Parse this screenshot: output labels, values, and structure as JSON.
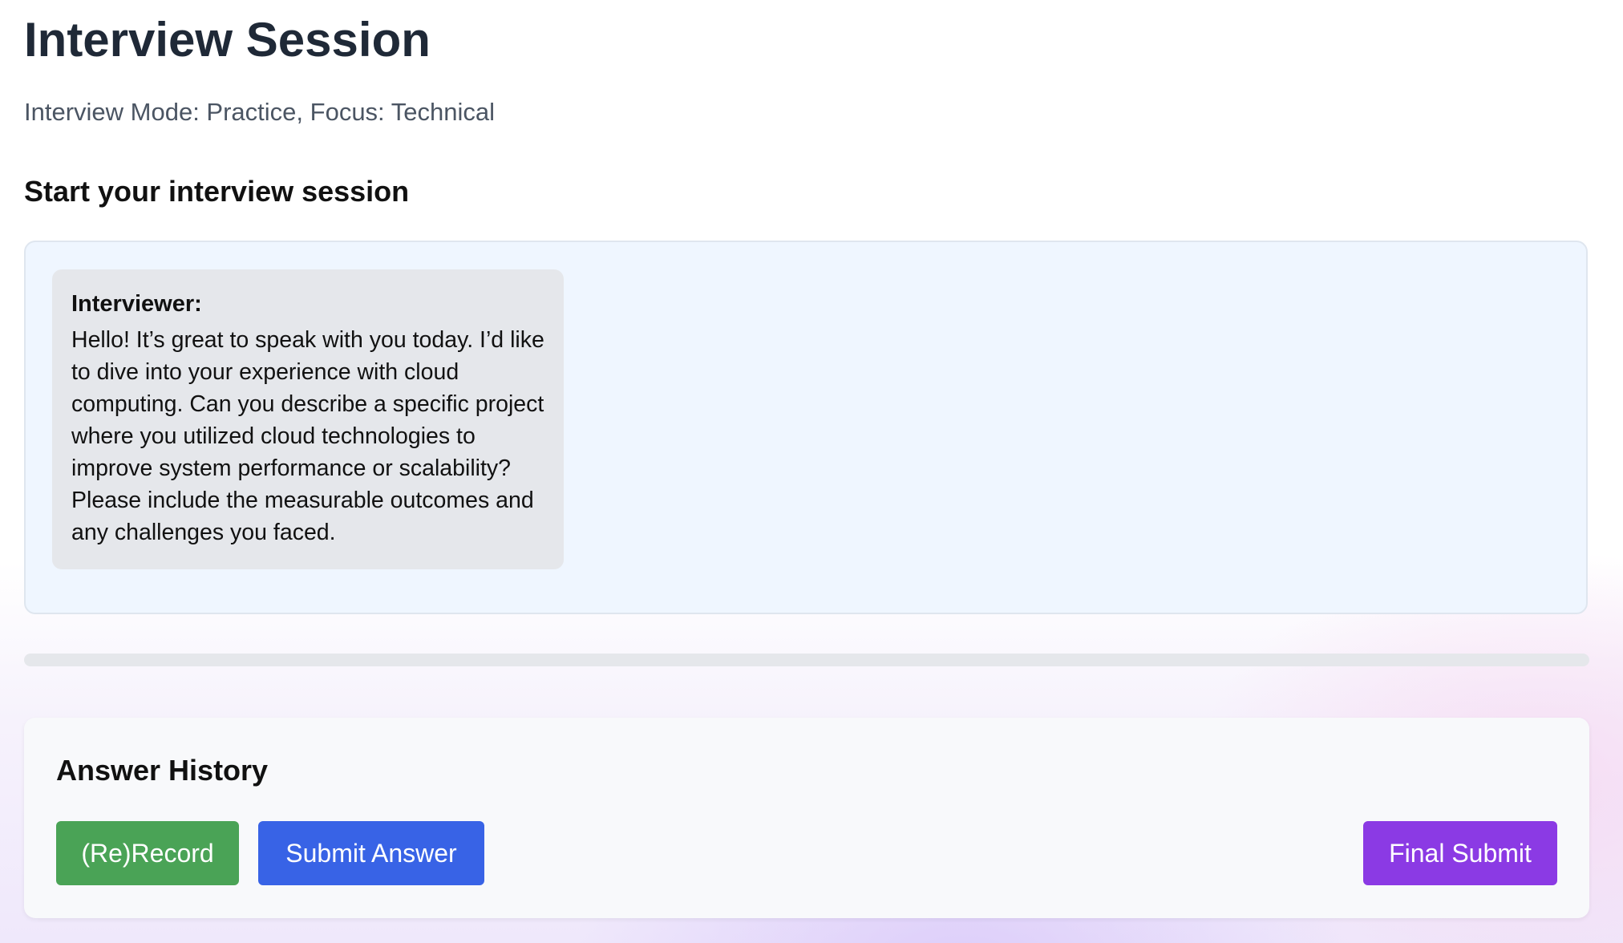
{
  "header": {
    "title": "Interview Session",
    "subtitle": "Interview Mode: Practice, Focus: Technical"
  },
  "session": {
    "heading": "Start your interview session",
    "messages": [
      {
        "sender": "Interviewer:",
        "text": "Hello! It’s great to speak with you today. I’d like to dive into your experience with cloud computing. Can you describe a specific project where you utilized cloud technologies to improve system performance or scalability? Please include the measurable outcomes and any challenges you faced."
      }
    ],
    "progress_fraction": 0
  },
  "answer_history": {
    "heading": "Answer History",
    "buttons": {
      "record_label": "(Re)Record",
      "submit_label": "Submit Answer",
      "final_submit_label": "Final Submit"
    }
  },
  "colors": {
    "record_button": "#4aa356",
    "submit_button": "#3863e6",
    "final_submit_button": "#8b3ae4",
    "chat_panel_background": "#eff6ff",
    "message_bubble_background": "#e5e7eb"
  }
}
